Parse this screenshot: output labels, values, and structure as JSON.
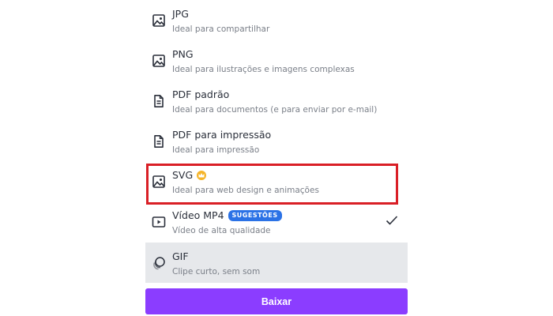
{
  "formats": [
    {
      "title": "JPG",
      "desc": "Ideal para compartilhar",
      "icon": "image-icon"
    },
    {
      "title": "PNG",
      "desc": "Ideal para ilustrações e imagens complexas",
      "icon": "image-icon"
    },
    {
      "title": "PDF padrão",
      "desc": "Ideal para documentos (e para enviar por e-mail)",
      "icon": "document-icon"
    },
    {
      "title": "PDF para impressão",
      "desc": "Ideal para impressão",
      "icon": "document-icon"
    },
    {
      "title": "SVG",
      "desc": "Ideal para web design e animações",
      "icon": "image-icon",
      "premium": true
    },
    {
      "title": "Vídeo MP4",
      "desc": "Vídeo de alta qualidade",
      "icon": "video-icon",
      "badge": "SUGESTÕES",
      "checked": true
    },
    {
      "title": "GIF",
      "desc": "Clipe curto, sem som",
      "icon": "gif-icon",
      "selected": true
    }
  ],
  "download_button": {
    "label": "Baixar"
  },
  "colors": {
    "accent": "#8b3dff",
    "highlight_border": "#d91f26",
    "badge": "#2b72e6",
    "premium": "#f5b428",
    "selected_row": "#e6e8eb"
  }
}
